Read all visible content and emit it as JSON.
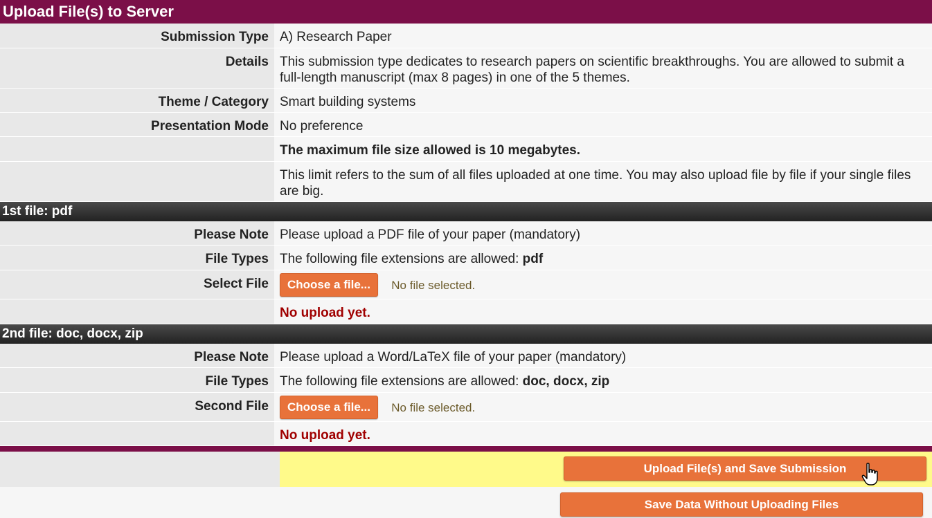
{
  "title": "Upload File(s) to Server",
  "info": {
    "submission_type_label": "Submission Type",
    "submission_type_value": "A) Research Paper",
    "details_label": "Details",
    "details_value": "This submission type dedicates to research papers on scientific breakthroughs. You are allowed to submit a full-length manuscript (max 8 pages) in one of the 5 themes.",
    "theme_label": "Theme / Category",
    "theme_value": "Smart building systems",
    "presentation_label": "Presentation Mode",
    "presentation_value": "No preference",
    "max_size_text": "The maximum file size allowed is 10 megabytes.",
    "limit_text": "This limit refers to the sum of all files uploaded at one time. You may also upload file by file if your single files are big."
  },
  "file1": {
    "header": "1st file: pdf",
    "note_label": "Please Note",
    "note_value": "Please upload a PDF file of your paper (mandatory)",
    "types_label": "File Types",
    "types_prefix": "The following file extensions are allowed:",
    "types_ext": "pdf",
    "select_label": "Select File",
    "choose_button": "Choose a file...",
    "file_status": "No file selected.",
    "upload_status": "No upload yet."
  },
  "file2": {
    "header": "2nd file: doc, docx, zip",
    "note_label": "Please Note",
    "note_value": "Please upload a Word/LaTeX file of your paper (mandatory)",
    "types_label": "File Types",
    "types_prefix": "The following file extensions are allowed:",
    "types_ext": "doc, docx, zip",
    "select_label": "Second File",
    "choose_button": "Choose a file...",
    "file_status": "No file selected.",
    "upload_status": "No upload yet."
  },
  "actions": {
    "upload_button": "Upload File(s) and Save Submission",
    "save_button": "Save Data Without Uploading Files"
  },
  "colors": {
    "title_bar": "#7b0f48",
    "button": "#e8723a",
    "action_highlight": "#fffa8a",
    "error_text": "#a00000"
  }
}
